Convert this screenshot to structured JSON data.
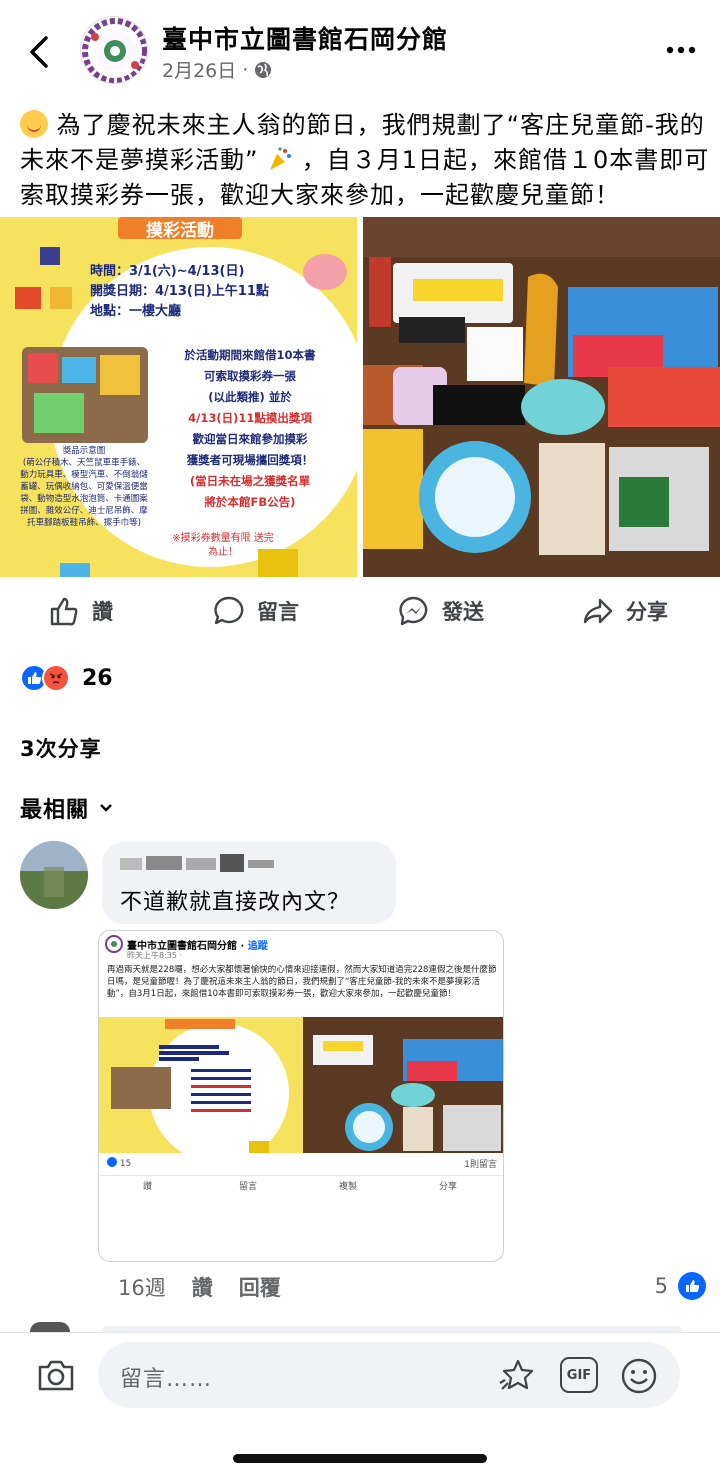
{
  "header": {
    "page_name": "臺中市立圖書館石岡分館",
    "date": "2月26日",
    "separator": "·"
  },
  "post": {
    "text_before": "為了慶祝未來主人翁的節日，我們規劃了“客庄兒童節-我的未來不是夢摸彩活動”",
    "text_after": "，自３月1日起，來館借１0本書即可索取摸彩券一張，歡迎大家來參加，一起歡慶兒童節！"
  },
  "poster": {
    "title": "摸彩活動",
    "time": "時間：3/1(六)~4/13(日)",
    "draw_date": "開獎日期：4/13(日)上午11點",
    "place": "地點：一樓大廳",
    "body": [
      "於活動期間來館借10本書",
      "可索取摸彩券一張",
      "(以此類推) 並於",
      "4/13(日)11點摸出獎項",
      "歡迎當日來館參加摸彩",
      "獲獎者可現場攜回獎項！",
      "(當日未在場之獲獎名單",
      "將於本館FB公告)"
    ],
    "prize_title": "獎品示意圖",
    "prize_list": "(萌公仔積木、天竺鼠車車手錶、動力玩具車、模型汽車、不倒翁儲蓄罐、玩偶收納包、可愛保溫便當袋、動物造型水泡泡筒、卡通圖案拼圖、雜效公仔、迪士尼吊飾、摩托車腳踏板鞋吊飾、擦手巾等)",
    "note": "※摸彩券數量有限 送完為止！"
  },
  "actions": {
    "like": "讚",
    "comment": "留言",
    "send": "發送",
    "share": "分享"
  },
  "reactions": {
    "count": "26"
  },
  "shares": "3次分享",
  "sort": {
    "label": "最相關"
  },
  "comment": {
    "text": "不道歉就直接改內文？",
    "time": "16週",
    "like": "讚",
    "reply": "回覆",
    "likes": "5"
  },
  "screenshot": {
    "page_name": "臺中市立圖書館石岡分館",
    "follow": "追蹤",
    "time": "昨天上午8:35 · ",
    "text": "再過兩天就是228囉，想必大家都懷著愉快的心情來迎接連假，然而大家知道過完228連假之後是什麼節日嗎，是兒童節喔！為了慶祝這未來主人翁的節日，我們規劃了“客庄兒童節-我的未來不是夢摸彩活動”，自3月1日起，來館借10本書即可索取摸彩券一張，歡迎大家來參加，一起歡慶兒童節！",
    "reactions": "15",
    "comments": "1則留言",
    "like": "讚",
    "comment": "留言",
    "copy": "複製",
    "share": "分享"
  },
  "composer": {
    "placeholder": "留言……",
    "gif": "GIF"
  },
  "colors": {
    "brand": "#0866ff",
    "angry": "#f5533d",
    "text_secondary": "#65676b"
  }
}
